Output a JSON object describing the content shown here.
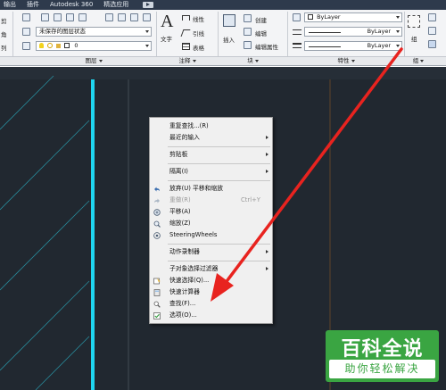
{
  "menubar": {
    "items": [
      "输出",
      "插件",
      "Autodesk 360",
      "精选应用"
    ]
  },
  "ribbon": {
    "left_labels": [
      "剪",
      "角",
      "列"
    ],
    "layer": {
      "layer_state": "未保存的图层状态",
      "current_layer": "0",
      "panel_title": "图层"
    },
    "annotation": {
      "text_label": "文字",
      "linear_label": "线性",
      "leader_label": "引线",
      "table_label": "表格",
      "panel_title": "注释"
    },
    "block": {
      "insert_label": "插入",
      "create_label": "创建",
      "edit_label": "编辑",
      "edit_attr_label": "编辑属性",
      "panel_title": "块"
    },
    "properties": {
      "color": "ByLayer",
      "linetype": "ByLayer",
      "lineweight": "ByLayer",
      "panel_title": "特性"
    },
    "group": {
      "group_label": "组",
      "panel_title": "组"
    }
  },
  "context_menu": {
    "items": [
      {
        "label": "重复查找...(R)",
        "icon": "",
        "submenu": false,
        "disabled": false,
        "shortcut": ""
      },
      {
        "label": "最近的输入",
        "icon": "",
        "submenu": true,
        "disabled": false,
        "shortcut": ""
      },
      {
        "label": "剪贴板",
        "icon": "",
        "submenu": true,
        "disabled": false,
        "shortcut": ""
      },
      {
        "label": "隔离(I)",
        "icon": "",
        "submenu": true,
        "disabled": false,
        "shortcut": ""
      },
      {
        "label": "放弃(U) 平移和缩放",
        "icon": "undo-icon",
        "submenu": false,
        "disabled": false,
        "shortcut": ""
      },
      {
        "label": "重做(R)",
        "icon": "redo-icon",
        "submenu": false,
        "disabled": true,
        "shortcut": "Ctrl+Y"
      },
      {
        "label": "平移(A)",
        "icon": "pan-icon",
        "submenu": false,
        "disabled": false,
        "shortcut": ""
      },
      {
        "label": "缩放(Z)",
        "icon": "zoom-icon",
        "submenu": false,
        "disabled": false,
        "shortcut": ""
      },
      {
        "label": "SteeringWheels",
        "icon": "steering-wheel-icon",
        "submenu": false,
        "disabled": false,
        "shortcut": ""
      },
      {
        "label": "动作录制器",
        "icon": "",
        "submenu": true,
        "disabled": false,
        "shortcut": ""
      },
      {
        "label": "子对象选择过滤器",
        "icon": "",
        "submenu": true,
        "disabled": false,
        "shortcut": ""
      },
      {
        "label": "快速选择(Q)...",
        "icon": "quick-select-icon",
        "submenu": false,
        "disabled": false,
        "shortcut": ""
      },
      {
        "label": "快速计算器",
        "icon": "calculator-icon",
        "submenu": false,
        "disabled": false,
        "shortcut": ""
      },
      {
        "label": "查找(F)...",
        "icon": "find-icon",
        "submenu": false,
        "disabled": false,
        "shortcut": ""
      },
      {
        "label": "选项(O)...",
        "icon": "options-icon",
        "submenu": false,
        "disabled": false,
        "shortcut": ""
      }
    ]
  },
  "watermark": {
    "title": "百科全说",
    "subtitle": "助你轻松解决"
  },
  "colors": {
    "menubar_bg": "#2e3a4c",
    "canvas_bg": "#212830",
    "cyan_line": "#1fd6f0",
    "arrow_red": "#e8231f",
    "watermark_green": "#3aa542"
  }
}
